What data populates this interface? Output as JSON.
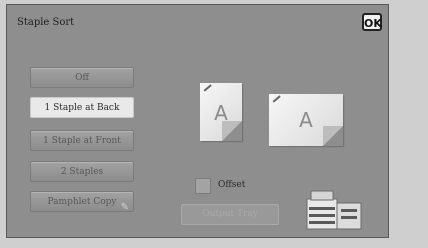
{
  "header": {
    "title": "Staple Sort",
    "ok_label": "OK"
  },
  "options": [
    {
      "label": "Off",
      "state": "disabled"
    },
    {
      "label": "1 Staple at Back",
      "state": "selected"
    },
    {
      "label": "1 Staple at Front",
      "state": "disabled"
    },
    {
      "label": "2 Staples",
      "state": "disabled"
    },
    {
      "label": "Pamphlet Copy",
      "state": "disabled"
    }
  ],
  "preview": {
    "paper_letter": "A"
  },
  "offset": {
    "label": "Offset",
    "checked": false
  },
  "ghost_button": {
    "label": "Output Tray"
  },
  "colors": {
    "panel": "#8e8e8e",
    "selected": "#e9e9e9",
    "border": "#5a5a5a"
  },
  "icons": {
    "machine": "copier-with-finisher-icon"
  }
}
